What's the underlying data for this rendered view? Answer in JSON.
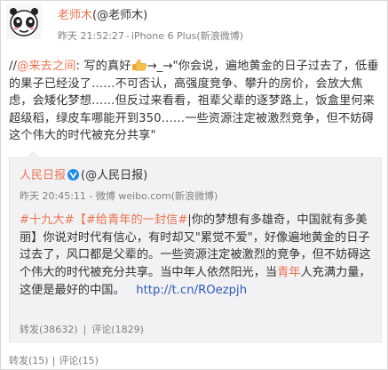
{
  "post": {
    "author_nick": "老师木",
    "author_handle": "(@老师木)",
    "time": "昨天 21:52:27",
    "source": "iPhone 6 Plus(新浪微博)",
    "text_prefix": "//",
    "mention": "@来去之间",
    "text_1": ": 写的真好",
    "text_2": "→_→\"你会说，遍地黄金的日子过去了，低垂的果子已经没了……不可否认，高强度竞争、攀升的房价，会放大焦虑，会矮化梦想……但反过来看看，祖辈父辈的逐梦路上，饭盒里何来超级稻，绿皮车哪能开到350……一些资源注定被激烈竞争，但不妨碍这个伟大的时代被充分共享\"",
    "share_count": "转发(15)",
    "comment_count": "评论(15)"
  },
  "quoted": {
    "author_nick": "人民日报",
    "author_handle": "(@人民日报)",
    "time": "昨天 20:45:11",
    "source": "微博 weibo.com(新浪微博)",
    "tag_1": "#十九大#",
    "tag_2_open": "【",
    "tag_2": "#给青年的一封信#",
    "text_1": "|你的梦想有多雄奇，中国就有多美丽】你说对时代有信心，有时却又\"累觉不爱\"，好像遍地黄金的日子过去了，风口都是父辈的。一些资源注定被激烈的竞争，但不妨碍这个伟大的时代被充分共享。当中年人依然阳光，当",
    "text_qing": "青年",
    "text_2": "人充满力量，这便是最好的中国。",
    "url": "http://t.cn/ROezpjh",
    "share_count": "转发(38632)",
    "comment_count": "评论(1829)"
  },
  "colors": {
    "accent": "#eb7350",
    "link_blue": "#2e5ab8",
    "meta_gray": "#808080",
    "quote_bg": "#f2f2f5"
  },
  "icons": {
    "avatar": "panda-avatar",
    "thumb": "thumbs-up-icon",
    "verified": "verified-v-icon"
  }
}
